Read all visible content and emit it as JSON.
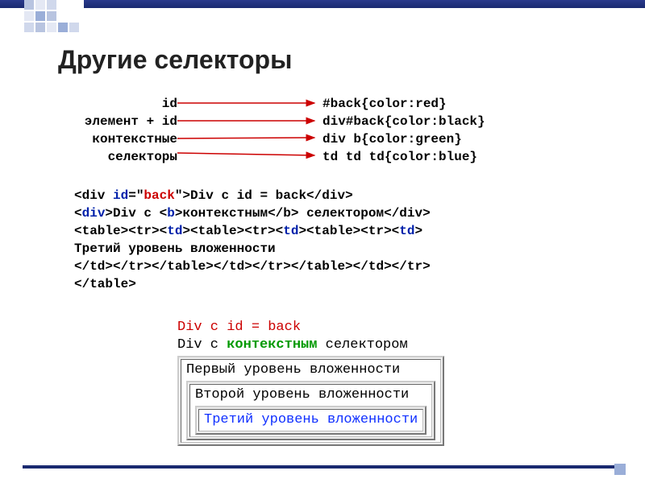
{
  "title": "Другие селекторы",
  "labels": {
    "id": "id",
    "element_id": "элемент + id",
    "context1": "контекстные",
    "context2": "селекторы"
  },
  "css": {
    "l1": "#back{color:red}",
    "l2": "div#back{color:black}",
    "l3": "div b{color:green}",
    "l4": "td td td{color:blue}"
  },
  "code": {
    "line1_a": "<div ",
    "line1_b": "id",
    "line1_c": "=\"",
    "line1_d": "back",
    "line1_e": "\">Div с id = back</div>",
    "line2_a": "<",
    "line2_b": "div",
    "line2_c": ">Div с <",
    "line2_d": "b",
    "line2_e": ">контекстным</b> селектором</div>",
    "line3_a": "<table><tr><",
    "line3_b": "td",
    "line3_c": "><table><tr><",
    "line3_d": "td",
    "line3_e": "><table><tr><",
    "line3_f": "td",
    "line3_g": ">",
    "line4": "Третий уровень вложенности",
    "line5": "</td></tr></table></td></tr></table></td></tr>",
    "line6": "</table>"
  },
  "output": {
    "r1": "Div с id = back",
    "r2_a": "Div с ",
    "r2_b": "контекстным",
    "r2_c": " селектором",
    "nest1": "Первый уровень вложенности",
    "nest2": "Второй уровень вложенности",
    "nest3": "Третий уровень вложенности"
  }
}
